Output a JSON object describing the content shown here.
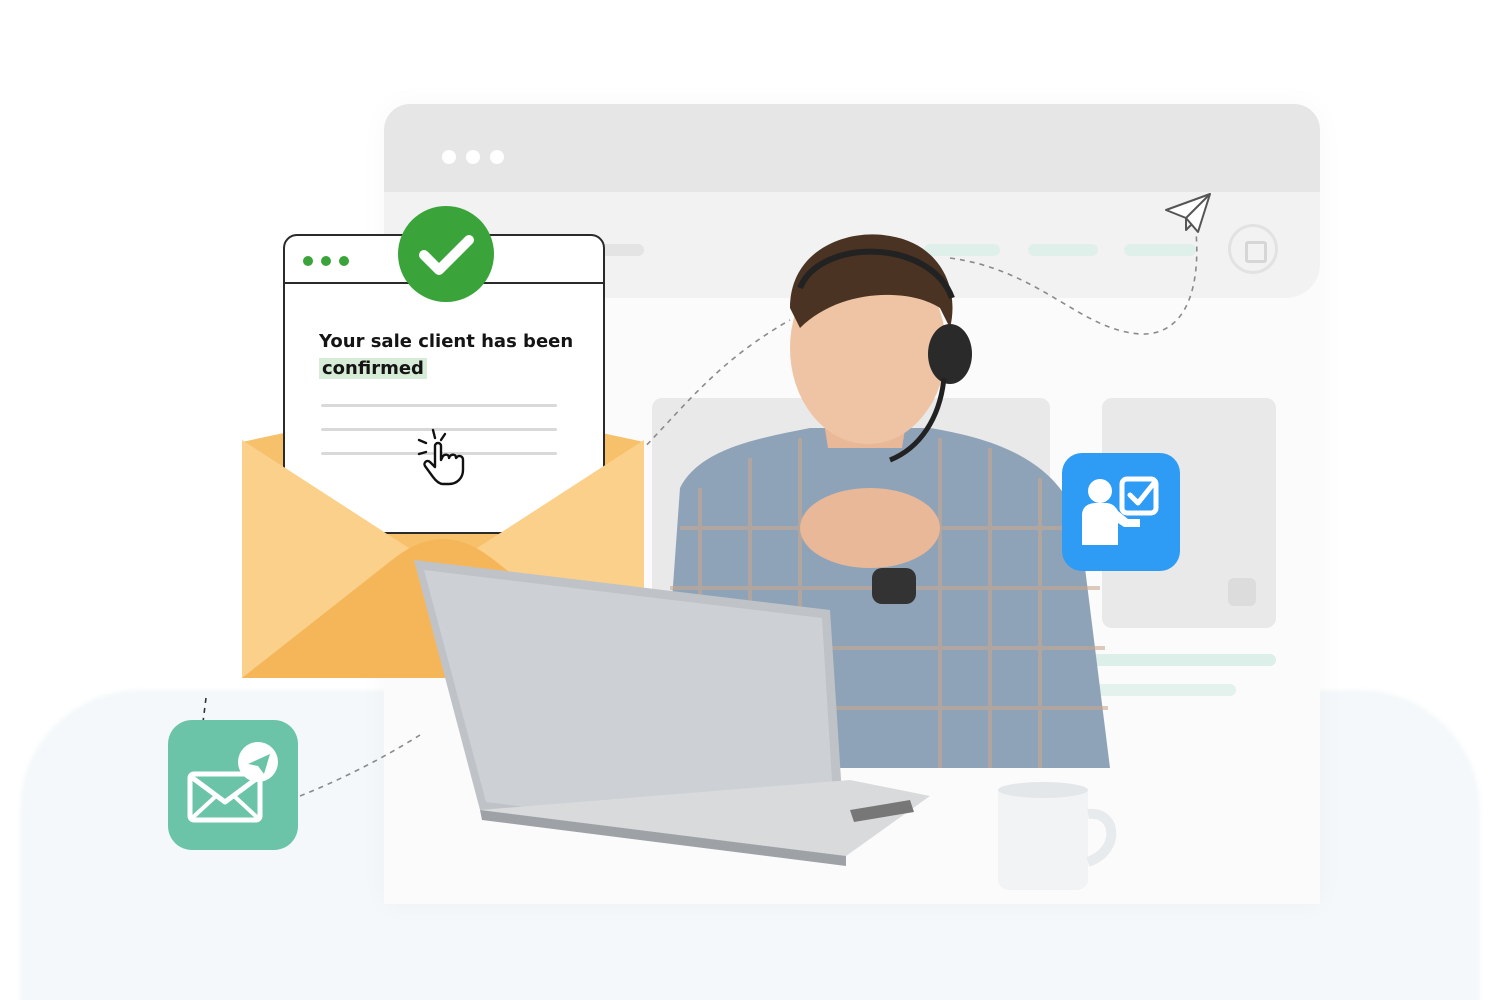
{
  "mail_card": {
    "message_part1": "Your sale client has been ",
    "message_highlight": "confirmed"
  },
  "colors": {
    "check_green": "#3aa33a",
    "highlight_green": "#d6ecd6",
    "envelope_orange": "#f7c06a",
    "icon_blue": "#2e9bf5",
    "icon_mint": "#6bc4a8",
    "window_grey": "#e6e6e6"
  },
  "icons": {
    "check": "check-icon",
    "pointer": "click-pointer-icon",
    "person_task": "person-checklist-icon",
    "mail_send": "mail-send-icon",
    "paper_plane": "paper-plane-icon",
    "shopping_bag": "shopping-bag-icon"
  }
}
